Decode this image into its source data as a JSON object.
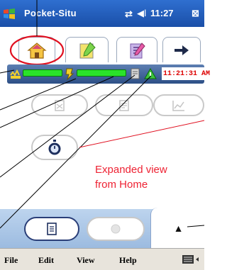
{
  "title_bar": {
    "app_title": "Pocket-Situ",
    "clock": "11:27",
    "signal_icon": "connectivity-icon",
    "speaker_icon": "speaker-icon"
  },
  "toolbar": {
    "tabs": [
      {
        "icon": "home-icon",
        "selected": true
      },
      {
        "icon": "notes-icon",
        "selected": false
      },
      {
        "icon": "edit-icon",
        "selected": false
      },
      {
        "icon": "arrow-right-icon",
        "selected": false
      }
    ]
  },
  "status_bar": {
    "time": "11:21:31 AM",
    "battery_icon": "battery-icon",
    "signal_icon": "signal-icon",
    "gps_icon": "gps-icon",
    "alert_icon": "alert-icon"
  },
  "caption": {
    "line1": "Expanded view",
    "line2": "from Home"
  },
  "bottom_tabs": {
    "expand_glyph": "▲"
  },
  "menu_bar": {
    "items": [
      "File",
      "Edit",
      "View",
      "Help"
    ]
  },
  "colors": {
    "title_bar": "#1a4fa8",
    "status_bar": "#3a5a90",
    "bar_green": "#2ae22a",
    "highlight": "#e01020",
    "annotation_line": "#000000",
    "caption_red": "#e22233"
  }
}
